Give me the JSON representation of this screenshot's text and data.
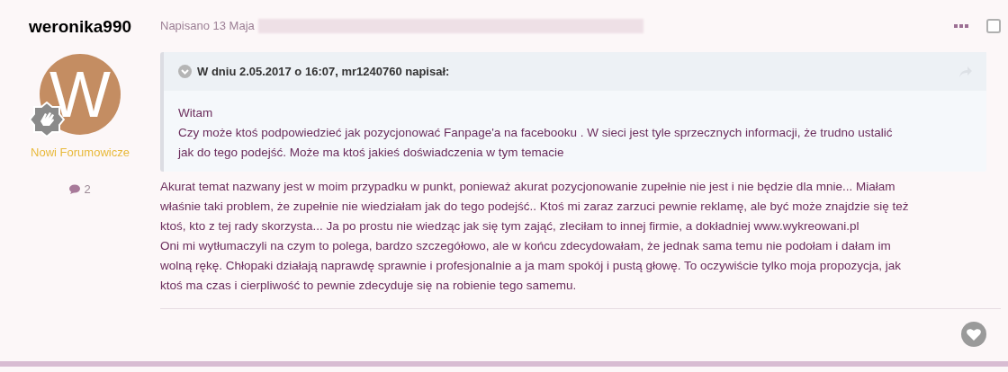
{
  "author": {
    "name": "weronika990",
    "avatar_letter": "W",
    "group": "Nowi Forumowicze",
    "post_count": "2"
  },
  "post": {
    "date": "Napisano 13 Maja",
    "selected": false,
    "quote": {
      "expanded": true,
      "header": "W dniu 2.05.2017 o 16:07, mr1240760 napisał:",
      "lines": [
        "Witam",
        "Czy może ktoś podpowiedzieć jak pozycjonować Fanpage'a na facebooku . W sieci jest tyle sprzecznych informacji, że trudno ustalić",
        "jak do tego podejść. Może ma ktoś jakieś doświadczenia w tym temacie"
      ]
    },
    "body": [
      "Akurat temat nazwany jest w moim przypadku w punkt, ponieważ akurat pozycjonowanie zupełnie nie jest i nie będzie dla mnie... Miałam",
      "właśnie taki problem, że zupełnie nie wiedziałam jak do tego podejść.. Ktoś mi zaraz zarzuci pewnie reklamę, ale być może znajdzie się też",
      "ktoś, kto z tej rady skorzysta... Ja po prostu nie wiedząc jak się tym zająć, zleciłam to innej firmie, a dokładniej www.wykreowani.pl",
      "Oni mi wytłumaczyli na czym to polega, bardzo szczegółowo, ale w końcu zdecydowałam, że jednak sama temu nie podołam i dałam im",
      "wolną rękę. Chłopaki działają naprawdę sprawnie i profesjonalnie a ja mam spokój i pustą głowę. To oczywiście tylko moja propozycja, jak",
      "ktoś ma czas i cierpliwość to pewnie zdecyduje się na robienie tego samemu."
    ]
  }
}
